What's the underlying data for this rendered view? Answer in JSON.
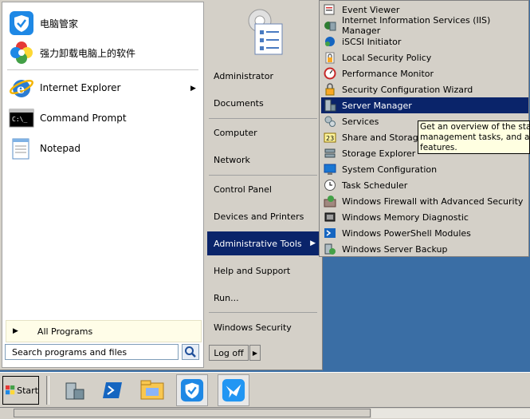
{
  "left_pane": {
    "pinned": [
      {
        "label": "电脑管家",
        "icon": "pc-manager-shield-icon"
      },
      {
        "label": "强力卸载电脑上的软件",
        "icon": "uninstaller-flower-icon"
      }
    ],
    "recent": [
      {
        "label": "Internet Explorer",
        "icon": "internet-explorer-icon",
        "has_submenu": true
      },
      {
        "label": "Command Prompt",
        "icon": "command-prompt-icon"
      },
      {
        "label": "Notepad",
        "icon": "notepad-icon"
      }
    ],
    "all_programs": "All Programs",
    "search_placeholder": "Search programs and files"
  },
  "right_pane": {
    "items": [
      {
        "label": "Administrator"
      },
      {
        "label": "Documents"
      },
      {
        "label": "Computer"
      },
      {
        "label": "Network"
      },
      {
        "label": "Control Panel"
      },
      {
        "label": "Devices and Printers"
      },
      {
        "label": "Administrative Tools",
        "selected": true,
        "has_submenu": true
      },
      {
        "label": "Help and Support"
      },
      {
        "label": "Run..."
      },
      {
        "label": "Windows Security"
      }
    ],
    "logoff": "Log off"
  },
  "admin_tools": {
    "items": [
      {
        "label": "Event Viewer",
        "icon": "event-viewer-icon"
      },
      {
        "label": "Internet Information Services (IIS) Manager",
        "icon": "iis-manager-icon"
      },
      {
        "label": "iSCSI Initiator",
        "icon": "iscsi-initiator-icon"
      },
      {
        "label": "Local Security Policy",
        "icon": "local-security-policy-icon"
      },
      {
        "label": "Performance Monitor",
        "icon": "performance-monitor-icon"
      },
      {
        "label": "Security Configuration Wizard",
        "icon": "security-config-wizard-icon"
      },
      {
        "label": "Server Manager",
        "icon": "server-manager-icon",
        "selected": true
      },
      {
        "label": "Services",
        "icon": "services-icon"
      },
      {
        "label": "Share and Storage Management",
        "icon": "share-storage-icon"
      },
      {
        "label": "Storage Explorer",
        "icon": "storage-explorer-icon"
      },
      {
        "label": "System Configuration",
        "icon": "system-configuration-icon"
      },
      {
        "label": "Task Scheduler",
        "icon": "task-scheduler-icon"
      },
      {
        "label": "Windows Firewall with Advanced Security",
        "icon": "firewall-icon"
      },
      {
        "label": "Windows Memory Diagnostic",
        "icon": "memory-diagnostic-icon"
      },
      {
        "label": "Windows PowerShell Modules",
        "icon": "powershell-icon"
      },
      {
        "label": "Windows Server Backup",
        "icon": "server-backup-icon"
      }
    ]
  },
  "tooltip": {
    "lines": [
      "Get an overview of the statu",
      "management tasks, and add",
      "features."
    ]
  },
  "taskbar": {
    "start_label": "Start",
    "buttons": [
      {
        "icon": "server-manager-icon"
      },
      {
        "icon": "powershell-icon"
      },
      {
        "icon": "windows-explorer-folder-icon"
      },
      {
        "icon": "pc-manager-shield-icon"
      },
      {
        "icon": "bird-app-icon"
      }
    ]
  },
  "colors": {
    "selection": "#0a246a",
    "desktop": "#3a6ea5",
    "tooltip_bg": "#ffffe1"
  }
}
